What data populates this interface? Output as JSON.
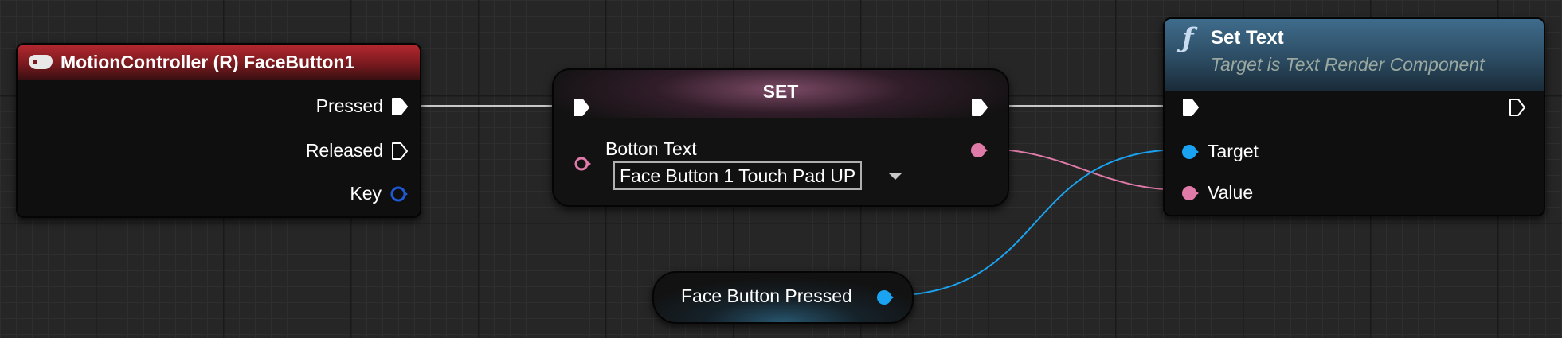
{
  "event_node": {
    "title": "MotionController (R) FaceButton1",
    "icon": "gamepad-icon",
    "header_color": "#b3282f",
    "pins": {
      "pressed": "Pressed",
      "released": "Released",
      "key": "Key"
    }
  },
  "set_node": {
    "title": "SET",
    "header_color": "#d278aa",
    "variable_label": "Botton Text",
    "value": "Face Button 1 Touch Pad UP"
  },
  "settext_node": {
    "icon": "function-icon",
    "title": "Set Text",
    "subtitle": "Target is Text Render Component",
    "header_color": "#3f6c8c",
    "pins": {
      "target": "Target",
      "value": "Value"
    }
  },
  "var_node": {
    "label": "Face Button Pressed",
    "color": "#1aa3f0"
  },
  "colors": {
    "exec_wire": "#c8c8c8",
    "text_pin": "#e07aa8",
    "object_pin": "#1aa3f0",
    "key_pin": "#1e5ad8"
  }
}
